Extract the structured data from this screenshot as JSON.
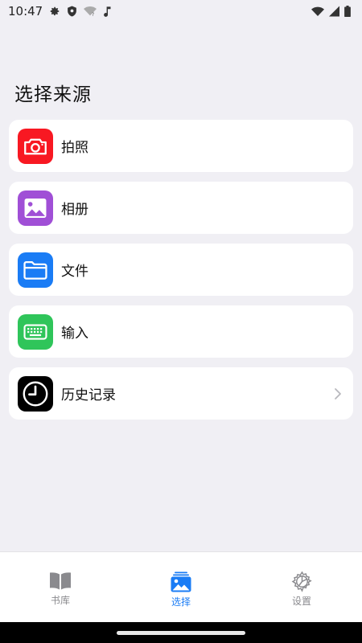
{
  "status": {
    "time": "10:47",
    "left_icons": [
      "gear-icon",
      "shield-icon",
      "wifi-question-icon",
      "music-note-icon"
    ],
    "right_icons": [
      "wifi-icon",
      "signal-icon",
      "battery-icon"
    ]
  },
  "page": {
    "title": "选择来源"
  },
  "sources": [
    {
      "label": "拍照",
      "icon": "camera-icon",
      "color": "#f81822"
    },
    {
      "label": "相册",
      "icon": "photo-icon",
      "color": "#a04fd6"
    },
    {
      "label": "文件",
      "icon": "folder-icon",
      "color": "#1a7cf5"
    },
    {
      "label": "输入",
      "icon": "keyboard-icon",
      "color": "#2fc55a"
    },
    {
      "label": "历史记录",
      "icon": "clock-icon",
      "color": "#000000"
    }
  ],
  "tabs": [
    {
      "label": "书库",
      "icon": "book-icon",
      "active": false
    },
    {
      "label": "选择",
      "icon": "photo-stack-icon",
      "active": true
    },
    {
      "label": "设置",
      "icon": "gear-icon",
      "active": false
    }
  ],
  "colors": {
    "accent": "#1a7cf5",
    "background": "#f0eff4",
    "card": "#ffffff",
    "inactive_tab": "#8a8a8e"
  }
}
